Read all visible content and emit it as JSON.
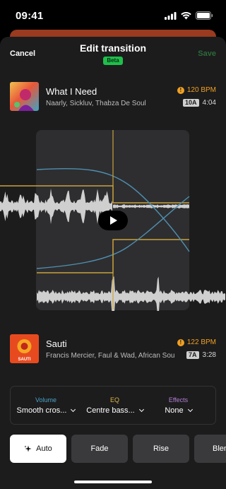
{
  "status": {
    "time": "09:41"
  },
  "nav": {
    "cancel": "Cancel",
    "title": "Edit transition",
    "badge": "Beta",
    "save": "Save"
  },
  "track_from": {
    "title": "What I Need",
    "artists": "Naarly, Sickluv, Thabza De Soul",
    "bpm": "120 BPM",
    "key": "10A",
    "duration": "4:04"
  },
  "track_to": {
    "title": "Sauti",
    "artists": "Francis Mercier, Faul & Wad, African Sou",
    "bpm": "122 BPM",
    "key": "7A",
    "duration": "3:28",
    "art_text": "SAUTI"
  },
  "controls": [
    {
      "label": "Volume",
      "value": "Smooth cros...",
      "color": "#4aa3c7"
    },
    {
      "label": "EQ",
      "value": "Centre bass...",
      "color": "#e0b54a"
    },
    {
      "label": "Effects",
      "value": "None",
      "color": "#b37fd6"
    }
  ],
  "presets": [
    "Auto",
    "Fade",
    "Rise",
    "Blen"
  ],
  "colors": {
    "accent_green": "#1fbf4a",
    "bpm_warning": "#f0a020",
    "volume_curve": "#4f8fb0",
    "eq_curve": "#c9a23a"
  },
  "icons": {
    "sparkle": "sparkle-icon",
    "play": "play-icon",
    "warning": "warning-icon"
  }
}
